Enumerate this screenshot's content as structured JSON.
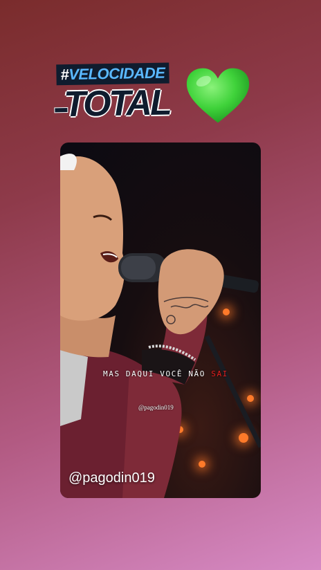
{
  "story": {
    "sticker": {
      "hashtag_symbol": "#",
      "hashtag_word": "VELOCIDADE",
      "second_line": "TOTAL"
    },
    "heart_icon": "green-heart-emoji",
    "heart_color": "#3fd23a",
    "video": {
      "caption_main": "MAS DAQUI VOCÊ NÃO ",
      "caption_tail": "SAI",
      "small_handle": "@pagodin019",
      "big_handle": "@pagodin019"
    }
  },
  "colors": {
    "background_top": "#7a2c2c",
    "background_bottom": "#d68ac4",
    "sticker_dark": "#0f1c2e",
    "sticker_accent": "#5ab8ff",
    "caption_highlight": "#e62020"
  }
}
